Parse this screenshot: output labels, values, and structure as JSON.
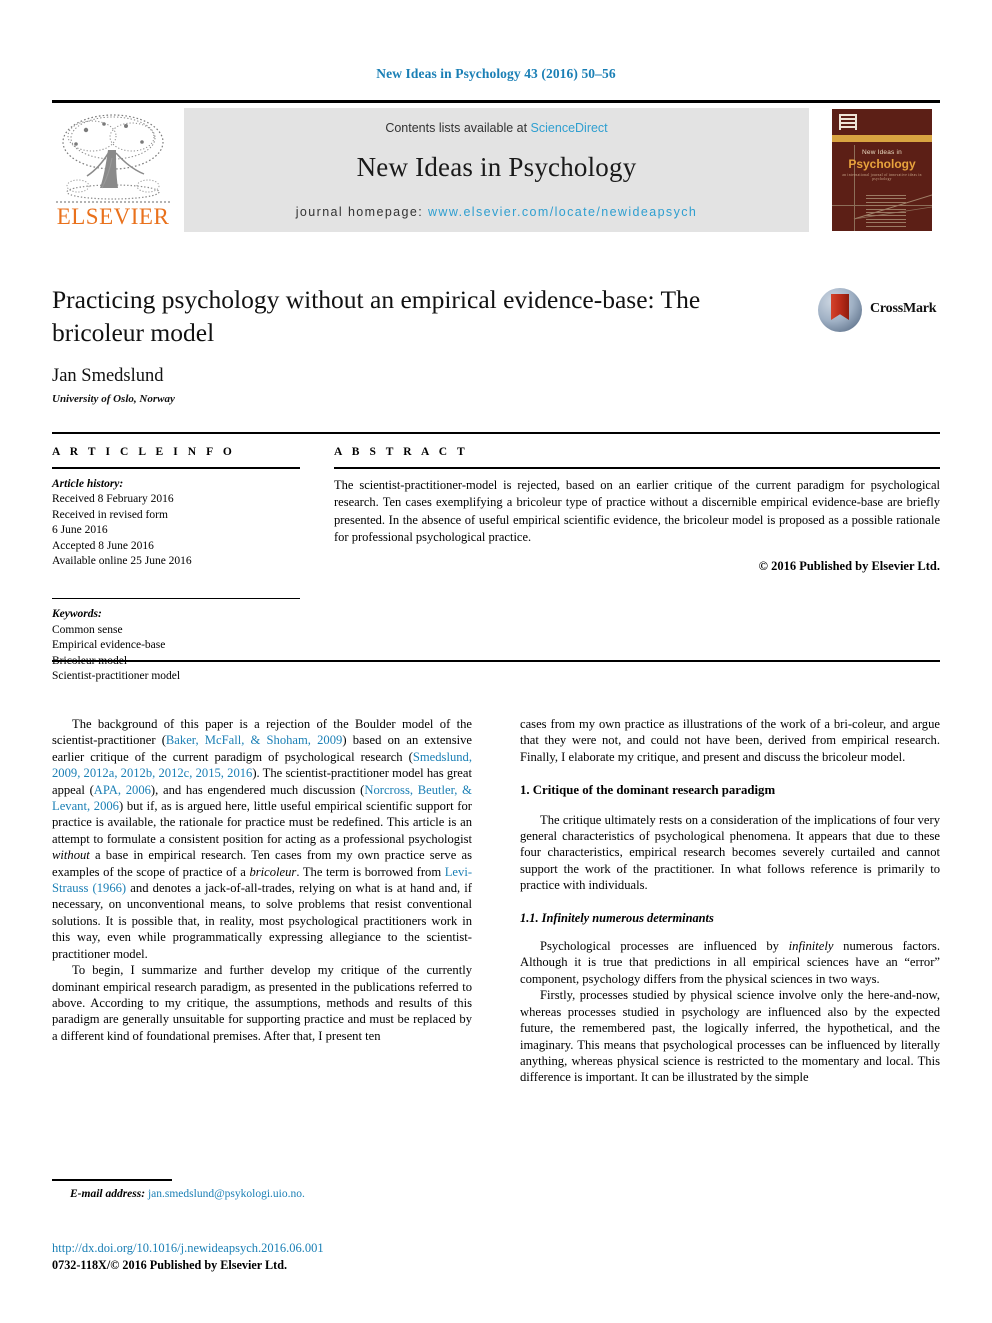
{
  "running_head": "New Ideas in Psychology 43 (2016) 50–56",
  "masthead": {
    "contents_prefix": "Contents lists available at ",
    "sciencedirect": "ScienceDirect",
    "journal_title": "New Ideas in Psychology",
    "homepage_prefix": "journal homepage: ",
    "homepage_url": "www.elsevier.com/locate/newideapsych",
    "publisher": "ELSEVIER",
    "accent_blue": "#2f9fd0",
    "publisher_orange": "#E9711C",
    "panel_gray": "#e3e3e3"
  },
  "cover": {
    "subtitle": "New Ideas in",
    "name": "Psychology",
    "tagline": "an international journal of innovative ideas in psychology",
    "background": "#5c1f16",
    "band": "#d9a441"
  },
  "article": {
    "title": "Practicing psychology without an empirical evidence-base: The bricoleur model",
    "author": "Jan Smedslund",
    "affiliation": "University of Oslo, Norway",
    "crossmark_label": "CrossMark"
  },
  "article_info": {
    "heading": "A R T I C L E   I N F O",
    "history_label": "Article history:",
    "history": [
      "Received 8 February 2016",
      "Received in revised form",
      "6 June 2016",
      "Accepted 8 June 2016",
      "Available online 25 June 2016"
    ],
    "keywords_label": "Keywords:",
    "keywords": [
      "Common sense",
      "Empirical evidence-base",
      "Bricoleur model",
      "Scientist-practitioner model"
    ]
  },
  "abstract": {
    "heading": "A B S T R A C T",
    "text": "The scientist-practitioner-model is rejected, based on an earlier critique of the current paradigm for psychological research. Ten cases exemplifying a bricoleur type of practice without a discernible empirical evidence-base are briefly presented. In the absence of useful empirical scientific evidence, the bricoleur model is proposed as a possible rationale for professional psychological practice.",
    "copyright": "© 2016 Published by Elsevier Ltd."
  },
  "body": {
    "left": {
      "p1_a": "The background of this paper is a rejection of the Boulder model of the scientist-practitioner (",
      "p1_ref1": "Baker, McFall, & Shoham, 2009",
      "p1_b": ") based on an extensive earlier critique of the current paradigm of psychological research (",
      "p1_ref2": "Smedslund, 2009, 2012a, 2012b, 2012c, 2015, 2016",
      "p1_c": "). The scientist-practitioner model has great appeal (",
      "p1_ref3": "APA, 2006",
      "p1_d": "), and has engendered much discussion (",
      "p1_ref4": "Norcross, Beutler, & Levant, 2006",
      "p1_e": ") but if, as is argued here, little useful empirical scientific support for practice is available, the rationale for practice must be redefined. This article is an attempt to formulate a consistent position for acting as a professional psychologist ",
      "p1_em1": "without",
      "p1_f": " a base in empirical research. Ten cases from my own practice serve as examples of the scope of practice of a ",
      "p1_em2": "bricoleur",
      "p1_g": ". The term is borrowed from ",
      "p1_ref5": "Levi-Strauss (1966)",
      "p1_h": " and denotes a jack-of-all-trades, relying on what is at hand and, if necessary, on unconventional means, to solve problems that resist conventional solutions. It is possible that, in reality, most psychological practitioners work in this way, even while programmatically expressing allegiance to the scientist-practitioner model.",
      "p2": "To begin, I summarize and further develop my critique of the currently dominant empirical research paradigm, as presented in the publications referred to above. According to my critique, the assumptions, methods and results of this paradigm are generally unsuitable for supporting practice and must be replaced by a different kind of foundational premises. After that, I present ten"
    },
    "right": {
      "p1_a": "cases from my own practice as illustrations of the work of a bri-coleur, and argue that they were not, and could not have been, derived from empirical research. Finally, I elaborate my critique, and present and discuss the bricoleur model.",
      "section1_heading": "1. Critique of the dominant research paradigm",
      "p2": "The critique ultimately rests on a consideration of the implications of four very general characteristics of psychological phenomena. It appears that due to these four characteristics, empirical research becomes severely curtailed and cannot support the work of the practitioner. In what follows reference is primarily to practice with individuals.",
      "subsection_heading": "1.1. Infinitely numerous determinants",
      "p3_a": "Psychological processes are influenced by ",
      "p3_em": "infinitely",
      "p3_b": " numerous factors. Although it is true that predictions in all empirical sciences have an “error” component, psychology differs from the physical sciences in two ways.",
      "p4": "Firstly, processes studied by physical science involve only the here-and-now, whereas processes studied in psychology are influenced also by the expected future, the remembered past, the logically inferred, the hypothetical, and the imaginary. This means that psychological processes can be influenced by literally anything, whereas physical science is restricted to the momentary and local. This difference is important. It can be illustrated by the simple"
    }
  },
  "footer": {
    "email_label": "E-mail address:",
    "email": "jan.smedslund@psykologi.uio.no.",
    "doi": "http://dx.doi.org/10.1016/j.newideapsych.2016.06.001",
    "issn_line": "0732-118X/© 2016 Published by Elsevier Ltd."
  }
}
